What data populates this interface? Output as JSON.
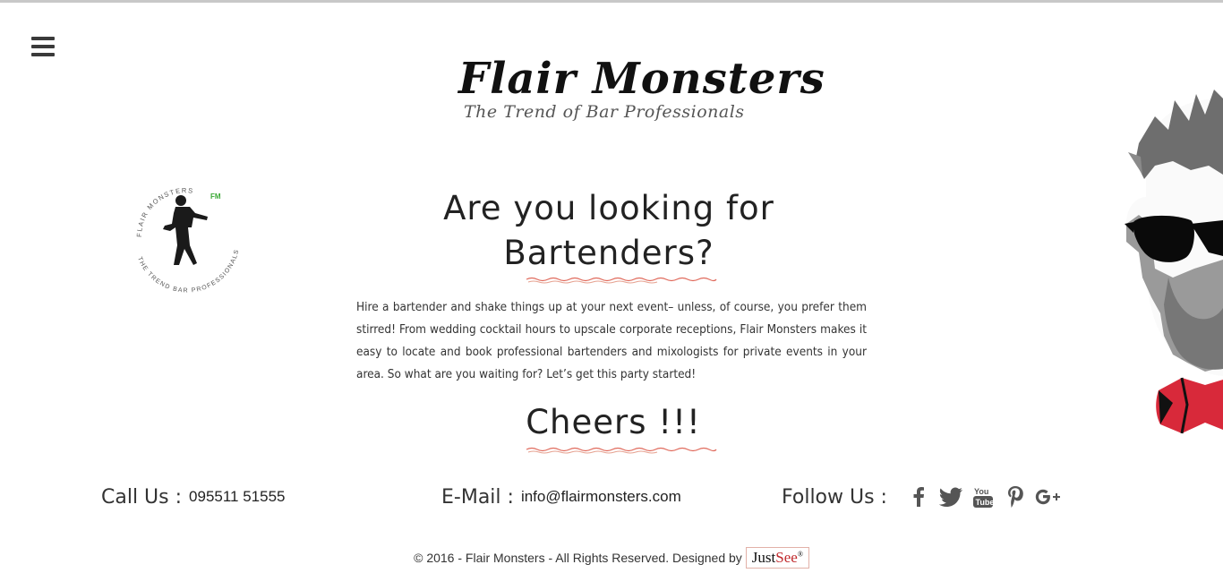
{
  "header": {
    "brand_title": "Flair Monsters",
    "brand_tagline": "The Trend of Bar Professionals",
    "menu_icon": "hamburger-icon"
  },
  "badge": {
    "top_text": "FLAIR   MONSTERS",
    "initials": "FM",
    "bottom_text": "THE TREND BAR PROFESSIONALS"
  },
  "main": {
    "headline_line1": "Are you looking for",
    "headline_line2": "Bartenders?",
    "intro": "Hire a bartender and shake things up at your next event– unless, of course, you prefer them stirred! From wedding cocktail hours to upscale corporate receptions, Flair Monsters makes it easy to locate and book professional bartenders and mixologists for private events in your area. So what are you waiting for? Let’s get this party started!",
    "cheers": "Cheers !!!"
  },
  "contact": {
    "call_label": "Call Us :",
    "call_value": "095511 51555",
    "email_label": "E-Mail :",
    "email_value": "info@flairmonsters.com",
    "follow_label": "Follow Us :",
    "social": [
      "facebook-icon",
      "twitter-icon",
      "youtube-icon",
      "pinterest-icon",
      "google-plus-icon"
    ]
  },
  "footer": {
    "copyright": "© 2016 - Flair Monsters - All Rights Reserved. Designed by",
    "credit_just": "Just",
    "credit_see": "See",
    "credit_mark": "®"
  },
  "colors": {
    "accent_red": "#c0282b",
    "badge_green": "#3aa935",
    "text_dark": "#222222"
  }
}
